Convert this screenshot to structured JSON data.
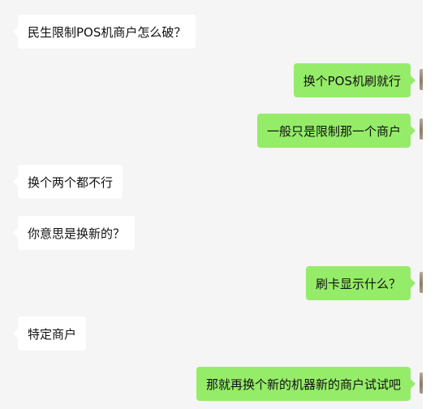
{
  "chat": {
    "messages": [
      {
        "side": "in",
        "text": "民生限制POS机商户怎么破？"
      },
      {
        "side": "out",
        "text": "换个POS机刷就行"
      },
      {
        "side": "out",
        "text": "一般只是限制那一个商户"
      },
      {
        "side": "in",
        "text": "换个两个都不行"
      },
      {
        "side": "in",
        "text": "你意思是换新的？"
      },
      {
        "side": "out",
        "text": "刷卡显示什么？"
      },
      {
        "side": "in",
        "text": "特定商户"
      },
      {
        "side": "out",
        "text": "那就再换个新的机器新的商户试试吧"
      }
    ]
  },
  "colors": {
    "chat_background": "#f5f5f5",
    "incoming_bubble": "#ffffff",
    "outgoing_bubble": "#95ec69",
    "text": "#111111"
  }
}
